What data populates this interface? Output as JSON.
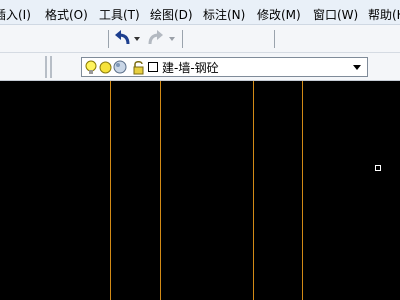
{
  "menubar": {
    "items": [
      {
        "label": "插入(I)"
      },
      {
        "label": "格式(O)"
      },
      {
        "label": "工具(T)"
      },
      {
        "label": "绘图(D)"
      },
      {
        "label": "标注(N)"
      },
      {
        "label": "修改(M)"
      },
      {
        "label": "窗口(W)"
      },
      {
        "label": "帮助(H)"
      }
    ]
  },
  "toolbar": {
    "undo_icon": "undo-arrow-icon",
    "redo_icon": "redo-arrow-icon"
  },
  "layers": {
    "current_layer": "建-墙-钢砼",
    "state_icons": [
      "lightbulb-on-icon",
      "sun-thaw-icon",
      "lock-icon",
      "color-swatch-icon"
    ]
  },
  "colors": {
    "canvas_background": "#000000",
    "wall_line": "#d28a16",
    "menubar_background": "#e9f0f8"
  }
}
